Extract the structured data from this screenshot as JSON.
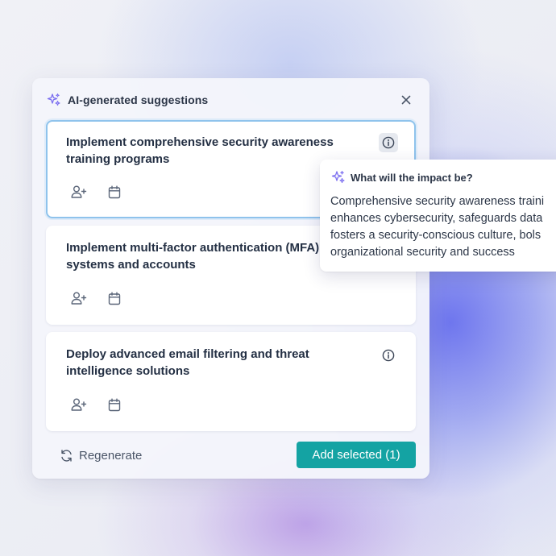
{
  "colors": {
    "accent": "#14a3a3",
    "selected_border": "#8fc3ec",
    "sparkle": "#7c6ff0",
    "icon": "#5a6578"
  },
  "panel": {
    "title": "AI-generated suggestions",
    "icon": "sparkle-icon",
    "close_icon": "close-icon"
  },
  "suggestions": [
    {
      "title": "Implement comprehensive security awareness training programs",
      "selected": true,
      "info_icon": "info-icon",
      "assign_icon": "add-user-icon",
      "date_icon": "calendar-icon"
    },
    {
      "title": "Implement multi-factor authentication (MFA) for systems and accounts",
      "selected": false,
      "assign_icon": "add-user-icon",
      "date_icon": "calendar-icon"
    },
    {
      "title": "Deploy advanced email filtering and threat intelligence solutions",
      "selected": false,
      "info_icon": "info-icon",
      "assign_icon": "add-user-icon",
      "date_icon": "calendar-icon"
    }
  ],
  "footer": {
    "regenerate_label": "Regenerate",
    "regenerate_icon": "refresh-icon",
    "add_label": "Add selected (1)"
  },
  "tooltip": {
    "title": "What will the impact be?",
    "lines": [
      "Comprehensive security awareness traini",
      "enhances cybersecurity, safeguards data",
      "fosters a security-conscious culture, bols",
      "organizational security and success"
    ]
  }
}
